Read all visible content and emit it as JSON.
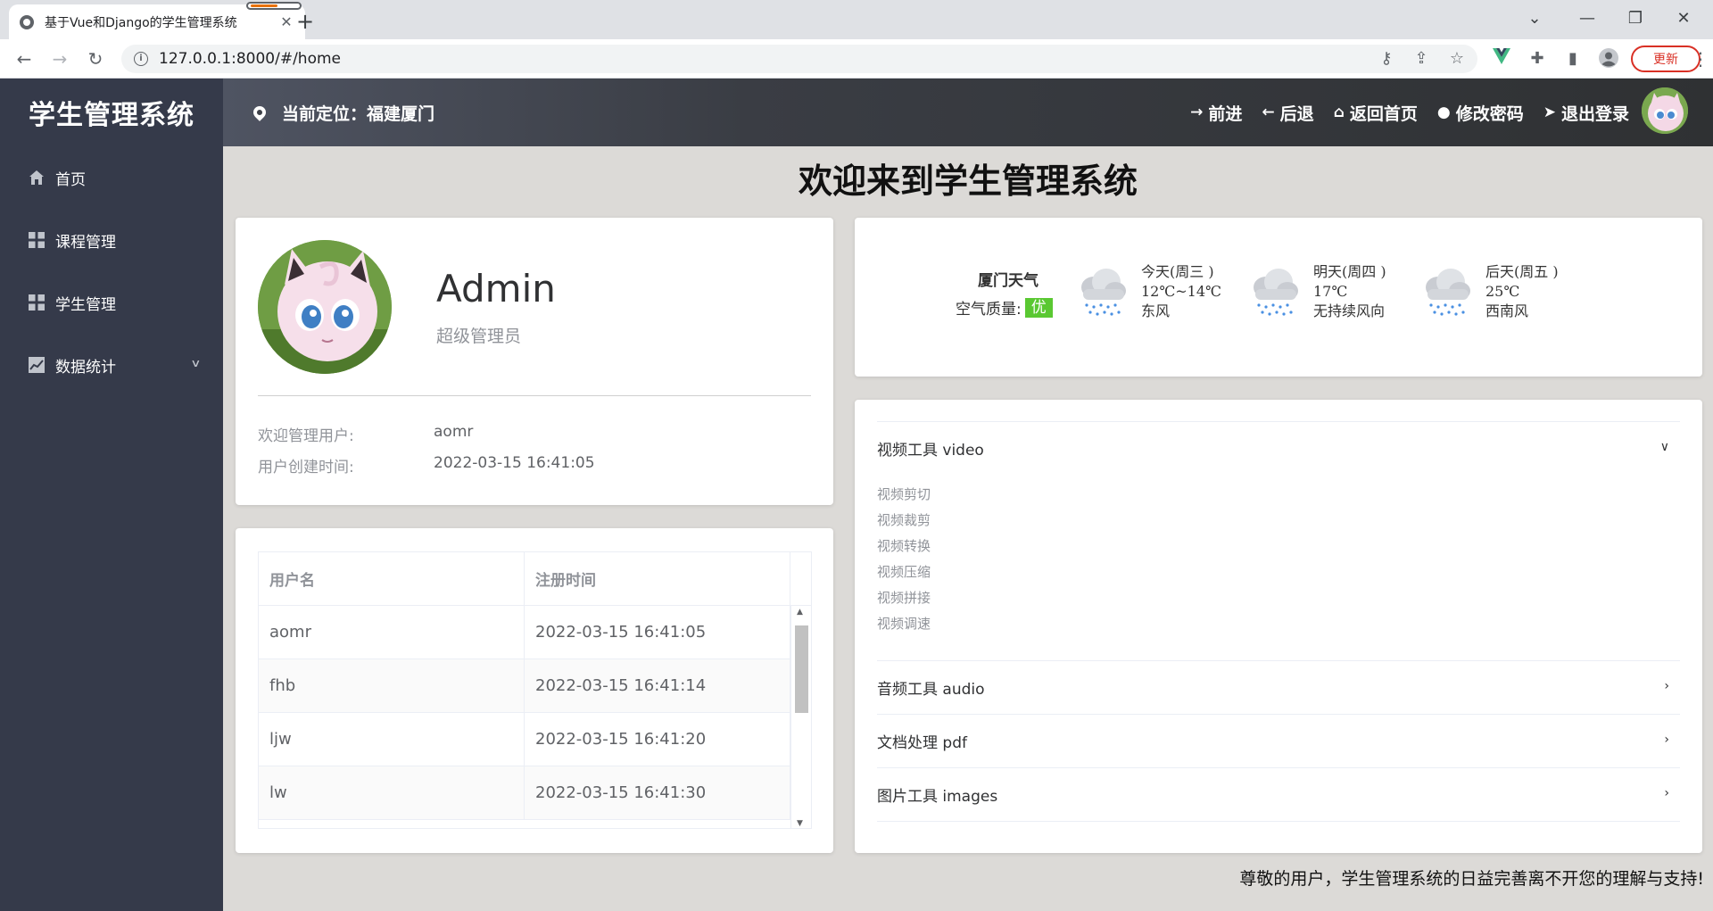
{
  "browser": {
    "tab_title": "基于Vue和Django的学生管理系统",
    "url": "127.0.0.1:8000/#/home",
    "update_label": "更新",
    "new_tab": "+",
    "close_tab": "✕",
    "win_minimize": "—",
    "win_restore": "❐",
    "win_close": "✕",
    "win_tabsearch": "⌄"
  },
  "sidebar": {
    "brand": "学生管理系统",
    "items": [
      {
        "label": "首页",
        "icon": "home-icon"
      },
      {
        "label": "课程管理",
        "icon": "grid-icon"
      },
      {
        "label": "学生管理",
        "icon": "grid-icon"
      },
      {
        "label": "数据统计",
        "icon": "chart-icon",
        "has_submenu": true
      }
    ]
  },
  "topbar": {
    "location": "当前定位：福建厦门",
    "actions": [
      {
        "label": "前进",
        "icon": "→"
      },
      {
        "label": "后退",
        "icon": "←"
      },
      {
        "label": "返回首页",
        "icon": "⌂"
      },
      {
        "label": "修改密码",
        "icon": "●"
      },
      {
        "label": "退出登录",
        "icon": "➤"
      }
    ]
  },
  "main": {
    "welcome": "欢迎来到学生管理系统",
    "footer": "尊敬的用户，学生管理系统的日益完善离不开您的理解与支持!"
  },
  "profile": {
    "name": "Admin",
    "role": "超级管理员",
    "user_label": "欢迎管理用户:",
    "user_value": "aomr",
    "created_label": "用户创建时间:",
    "created_value": "2022-03-15 16:41:05"
  },
  "users_table": {
    "headers": [
      "用户名",
      "注册时间"
    ],
    "rows": [
      {
        "name": "aomr",
        "time": "2022-03-15 16:41:05"
      },
      {
        "name": "fhb",
        "time": "2022-03-15 16:41:14"
      },
      {
        "name": "ljw",
        "time": "2022-03-15 16:41:20"
      },
      {
        "name": "lw",
        "time": "2022-03-15 16:41:30"
      }
    ]
  },
  "weather": {
    "city": "厦门天气",
    "aq_label": "空气质量:",
    "aq_value": "优",
    "aq_color": "#5ac832",
    "days": [
      {
        "day": "今天(周三 )",
        "temp": "12℃~14℃",
        "wind": "东风",
        "icon": "rain-cloud-icon"
      },
      {
        "day": "明天(周四 )",
        "temp": "17℃",
        "wind": "无持续风向",
        "icon": "rain-cloud-icon"
      },
      {
        "day": "后天(周五 )",
        "temp": "25℃",
        "wind": "西南风",
        "icon": "rain-cloud-icon"
      }
    ]
  },
  "tools": {
    "sections": [
      {
        "title": "视频工具 video",
        "expanded": true,
        "links": [
          "视频剪切",
          "视频裁剪",
          "视频转换",
          "视频压缩",
          "视频拼接",
          "视频调速"
        ]
      },
      {
        "title": "音频工具 audio",
        "expanded": false
      },
      {
        "title": "文档处理 pdf",
        "expanded": false
      },
      {
        "title": "图片工具 images",
        "expanded": false
      }
    ]
  }
}
